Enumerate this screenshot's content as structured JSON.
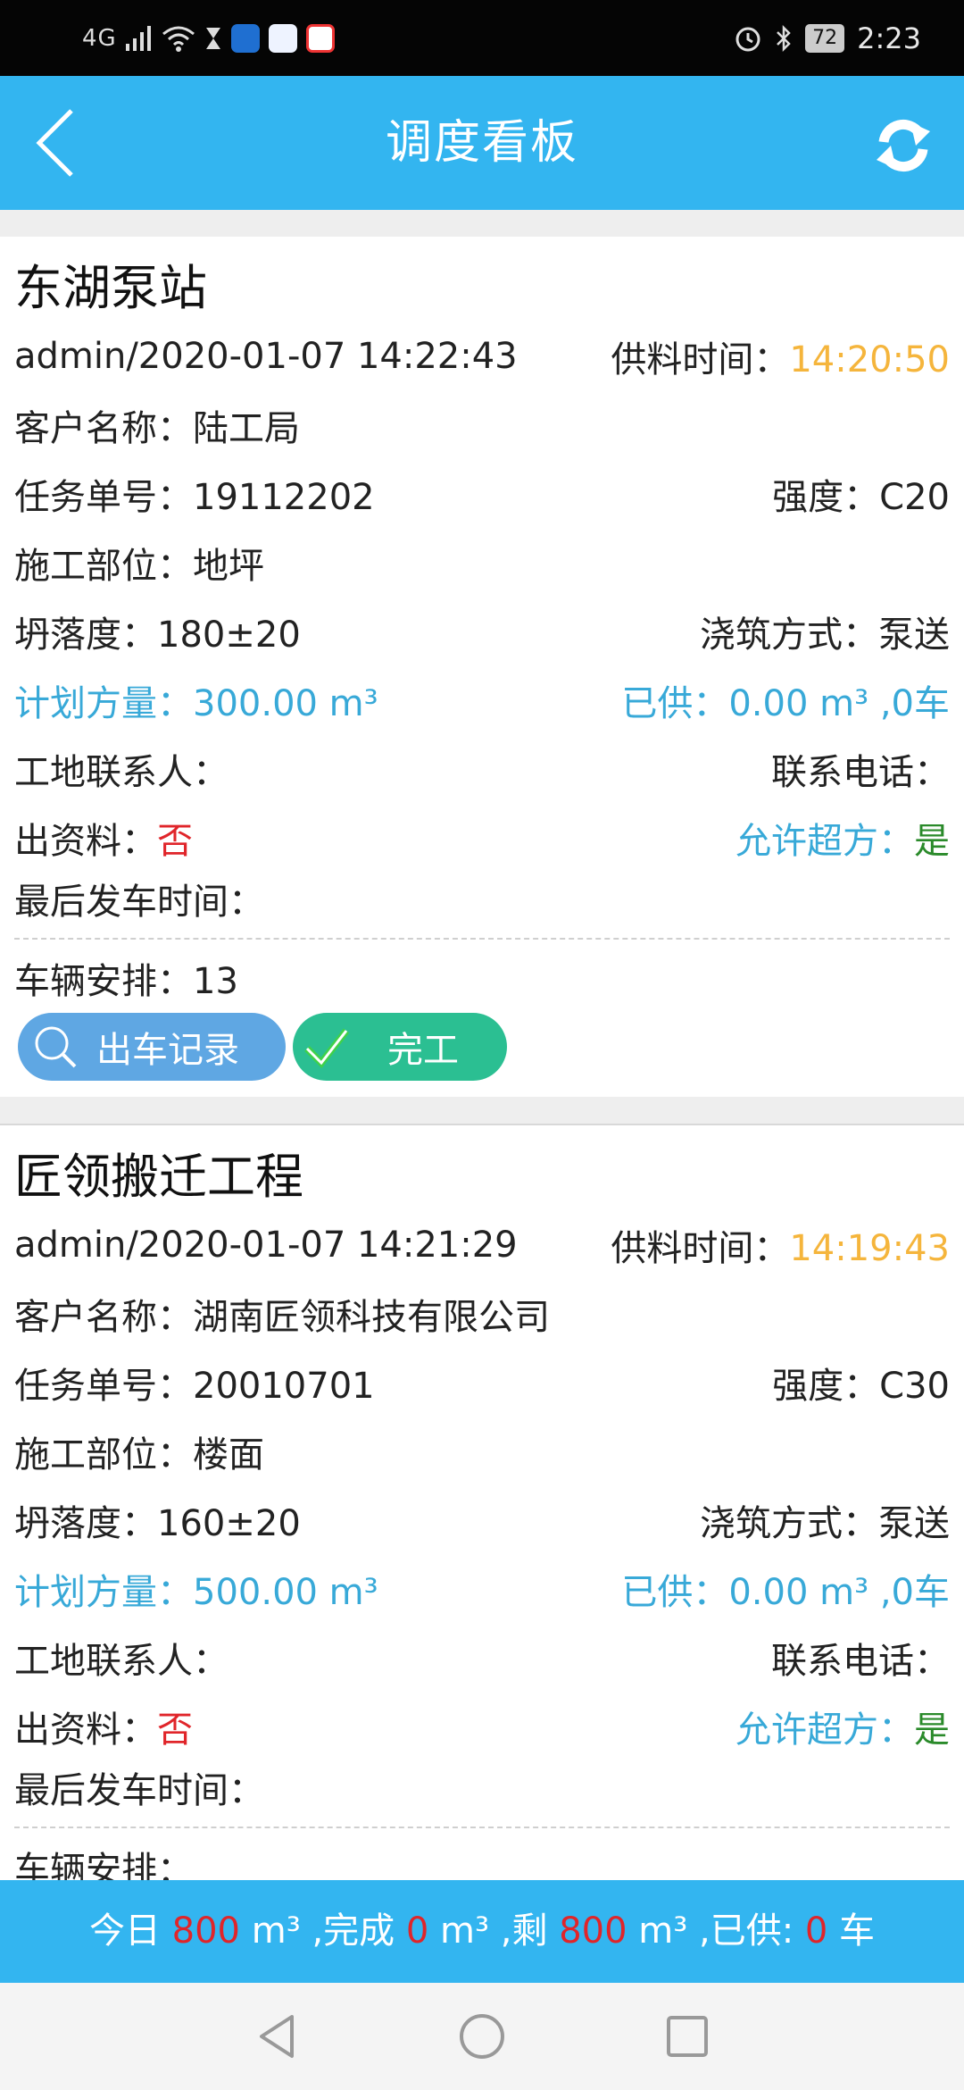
{
  "status_bar": {
    "signal": "4G",
    "time": "2:23",
    "battery": "72"
  },
  "header": {
    "title": "调度看板"
  },
  "tasks": [
    {
      "site": "东湖泵站",
      "user_time": "admin/2020-01-07 14:22:43",
      "supply_time_label": "供料时间：",
      "supply_time": "14:20:50",
      "customer_label": "客户名称：",
      "customer": "陆工局",
      "task_no_label": "任务单号：",
      "task_no": "19112202",
      "strength_label": "强度：",
      "strength": "C20",
      "part_label": "施工部位：",
      "part": "地坪",
      "slump_label": "坍落度：",
      "slump": "180±20",
      "pour_label": "浇筑方式：",
      "pour": "泵送",
      "plan_label": "计划方量：",
      "plan": "300.00 m³",
      "supplied": "已供：0.00 m³ ,0车",
      "contact_label": "工地联系人：",
      "phone_label": "联系电话：",
      "docs_label": "出资料：",
      "docs": "否",
      "over_label": "允许超方：",
      "over": "是",
      "last_dispatch_label": "最后发车时间：",
      "vehicles_label": "车辆安排：",
      "vehicles": "13",
      "btn_records": "出车记录",
      "btn_done": "完工"
    },
    {
      "site": "匠领搬迁工程",
      "user_time": "admin/2020-01-07 14:21:29",
      "supply_time_label": "供料时间：",
      "supply_time": "14:19:43",
      "customer_label": "客户名称：",
      "customer": "湖南匠领科技有限公司",
      "task_no_label": "任务单号：",
      "task_no": "20010701",
      "strength_label": "强度：",
      "strength": "C30",
      "part_label": "施工部位：",
      "part": "楼面",
      "slump_label": "坍落度：",
      "slump": "160±20",
      "pour_label": "浇筑方式：",
      "pour": "泵送",
      "plan_label": "计划方量：",
      "plan": "500.00 m³",
      "supplied": "已供：0.00 m³ ,0车",
      "contact_label": "工地联系人：",
      "phone_label": "联系电话：",
      "docs_label": "出资料：",
      "docs": "否",
      "over_label": "允许超方：",
      "over": "是",
      "last_dispatch_label": "最后发车时间：",
      "vehicles_label": "车辆安排："
    }
  ],
  "summary": {
    "t1": "今日 ",
    "today": "800",
    "t2": " m³ ,完成 ",
    "done": "0",
    "t3": " m³ ,剩 ",
    "remain": "800",
    "t4": " m³ ,已供: ",
    "supplied": "0",
    "t5": " 车"
  },
  "colors": {
    "header": "#33b5f0",
    "accent_orange": "#f5b53c",
    "alert_red": "#e0252a",
    "ok_green": "#2a8a2a",
    "link_blue": "#38a9d8"
  }
}
